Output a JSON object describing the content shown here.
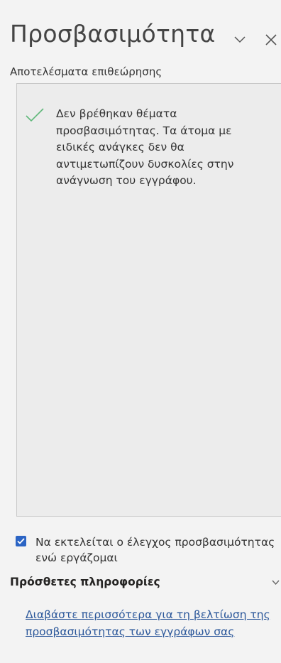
{
  "pane": {
    "title": "Προσβασιμότητα",
    "subtitle": "Αποτελέσματα επιθεώρησης"
  },
  "icons": {
    "options": "chevron-down-icon",
    "close": "close-icon",
    "result": "checkmark-icon",
    "checkbox": "checkbox-checked-icon",
    "expand": "chevron-down-icon"
  },
  "results": {
    "message": "Δεν βρέθηκαν θέματα προσβασιμότητας. Τα άτομα με ειδικές ανάγκες δεν θα αντιμετωπίζουν δυσκολίες στην ανάγνωση του εγγράφου."
  },
  "options": {
    "keep_running_label": "Να εκτελείται ο έλεγχος προσβασιμότητας ενώ εργάζομαι",
    "keep_running_checked": true
  },
  "more_info": {
    "heading": "Πρόσθετες πληροφορίες",
    "link_text": "Διαβάστε περισσότερα για τη βελτίωση της προσβασιμότητας των εγγράφων σας"
  },
  "colors": {
    "background": "#f3f3f3",
    "results_background": "#ececec",
    "check_green": "#5fb87a",
    "checkbox_blue": "#2b64c4",
    "link_blue": "#2b579a"
  }
}
